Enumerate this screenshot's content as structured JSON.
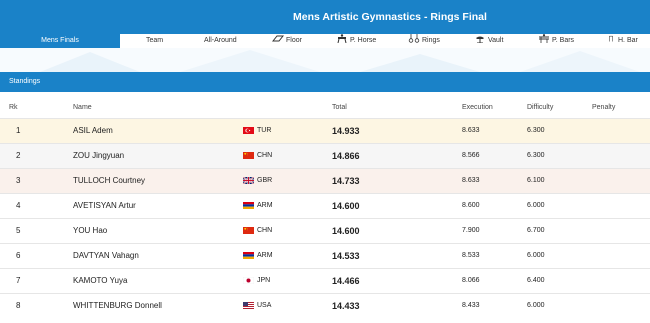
{
  "header": {
    "title": "Mens Artistic Gymnastics - Rings Final"
  },
  "nav": {
    "tabs": [
      {
        "label": "Mens Finals",
        "icon": ""
      },
      {
        "label": "Team",
        "icon": ""
      },
      {
        "label": "All-Around",
        "icon": ""
      },
      {
        "label": "Floor",
        "icon": "floor-icon"
      },
      {
        "label": "P. Horse",
        "icon": "pommel-horse-icon"
      },
      {
        "label": "Rings",
        "icon": "rings-icon"
      },
      {
        "label": "Vault",
        "icon": "vault-icon"
      },
      {
        "label": "P. Bars",
        "icon": "parallel-bars-icon"
      },
      {
        "label": "H. Bar",
        "icon": "high-bar-icon"
      }
    ]
  },
  "standings": {
    "label": "Standings",
    "columns": {
      "rank": "Rk",
      "name": "Name",
      "total": "Total",
      "execution": "Execution",
      "difficulty": "Difficulty",
      "penalty": "Penalty"
    },
    "rows": [
      {
        "rank": "1",
        "name": "ASIL Adem",
        "country": "TUR",
        "total": "14.933",
        "execution": "8.633",
        "difficulty": "6.300",
        "penalty": "",
        "medal": "gold"
      },
      {
        "rank": "2",
        "name": "ZOU Jingyuan",
        "country": "CHN",
        "total": "14.866",
        "execution": "8.566",
        "difficulty": "6.300",
        "penalty": "",
        "medal": "silver"
      },
      {
        "rank": "3",
        "name": "TULLOCH Courtney",
        "country": "GBR",
        "total": "14.733",
        "execution": "8.633",
        "difficulty": "6.100",
        "penalty": "",
        "medal": "bronze"
      },
      {
        "rank": "4",
        "name": "AVETISYAN Artur",
        "country": "ARM",
        "total": "14.600",
        "execution": "8.600",
        "difficulty": "6.000",
        "penalty": "",
        "medal": ""
      },
      {
        "rank": "5",
        "name": "YOU Hao",
        "country": "CHN",
        "total": "14.600",
        "execution": "7.900",
        "difficulty": "6.700",
        "penalty": "",
        "medal": ""
      },
      {
        "rank": "6",
        "name": "DAVTYAN Vahagn",
        "country": "ARM",
        "total": "14.533",
        "execution": "8.533",
        "difficulty": "6.000",
        "penalty": "",
        "medal": ""
      },
      {
        "rank": "7",
        "name": "KAMOTO Yuya",
        "country": "JPN",
        "total": "14.466",
        "execution": "8.066",
        "difficulty": "6.400",
        "penalty": "",
        "medal": ""
      },
      {
        "rank": "8",
        "name": "WHITTENBURG Donnell",
        "country": "USA",
        "total": "14.433",
        "execution": "8.433",
        "difficulty": "6.000",
        "penalty": "",
        "medal": ""
      }
    ]
  },
  "colors": {
    "accent": "#1a82c8",
    "gold_row": "#fdf6e3",
    "silver_row": "#f6f6f6",
    "bronze_row": "#faf1ec"
  }
}
